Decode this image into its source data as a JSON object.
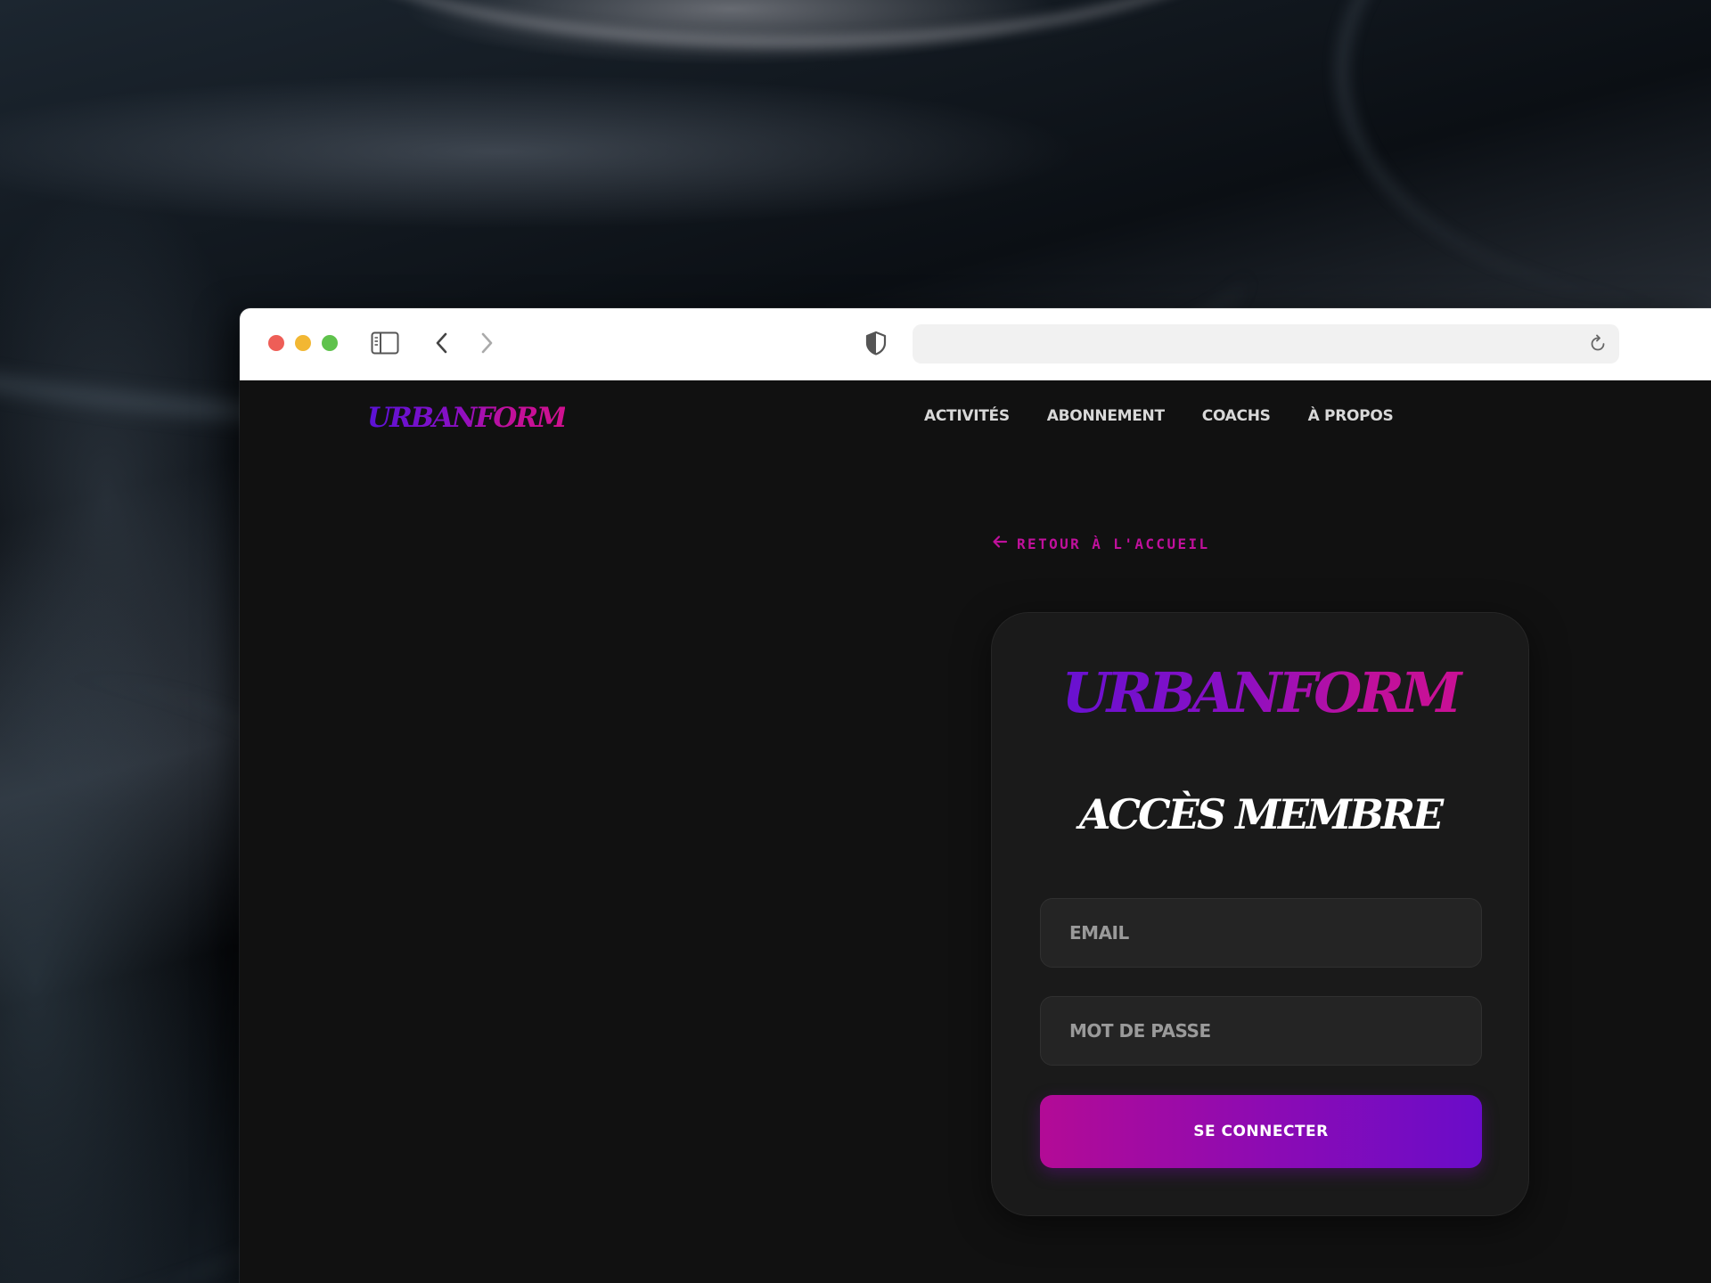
{
  "brand": {
    "name": "URBANFORM",
    "colors": {
      "purple": "#5a12d6",
      "magenta": "#d0118f"
    }
  },
  "browser": {
    "address_value": "",
    "icons": {
      "sidebar": "sidebar-icon",
      "back": "chevron-left-icon",
      "forward": "chevron-right-icon",
      "privacy": "shield-icon",
      "reload": "reload-icon"
    }
  },
  "nav": {
    "items": [
      {
        "label": "ACTIVITÉS"
      },
      {
        "label": "ABONNEMENT"
      },
      {
        "label": "COACHS"
      },
      {
        "label": "À PROPOS"
      }
    ]
  },
  "back_link": {
    "label": "RETOUR À L'ACCUEIL",
    "icon": "arrow-left-icon"
  },
  "login": {
    "title": "ACCÈS MEMBRE",
    "email": {
      "placeholder": "EMAIL",
      "value": ""
    },
    "password": {
      "placeholder": "MOT DE PASSE",
      "value": ""
    },
    "submit_label": "SE CONNECTER"
  }
}
